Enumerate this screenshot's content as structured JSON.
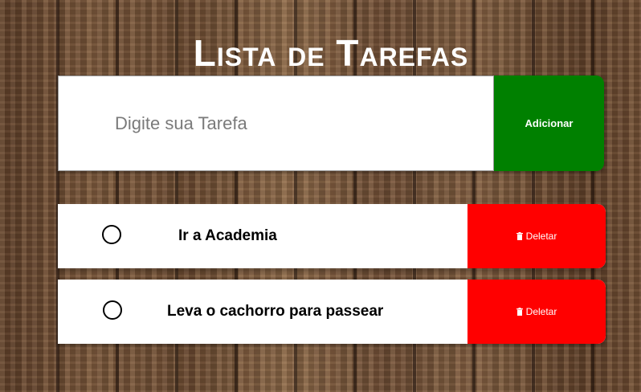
{
  "header": {
    "title": "Lista de Tarefas"
  },
  "input": {
    "placeholder": "Digite sua Tarefa",
    "value": ""
  },
  "add_button": {
    "label": "Adicionar",
    "color": "#008000"
  },
  "tasks": [
    {
      "text": "Ir a Academia",
      "done": false,
      "delete_label": "Deletar",
      "delete_icon": "trash-icon"
    },
    {
      "text": "Leva o cachorro para passear",
      "done": false,
      "delete_label": "Deletar",
      "delete_icon": "trash-icon"
    }
  ],
  "colors": {
    "delete": "#ff0000",
    "add": "#008000",
    "card": "#ffffff"
  }
}
